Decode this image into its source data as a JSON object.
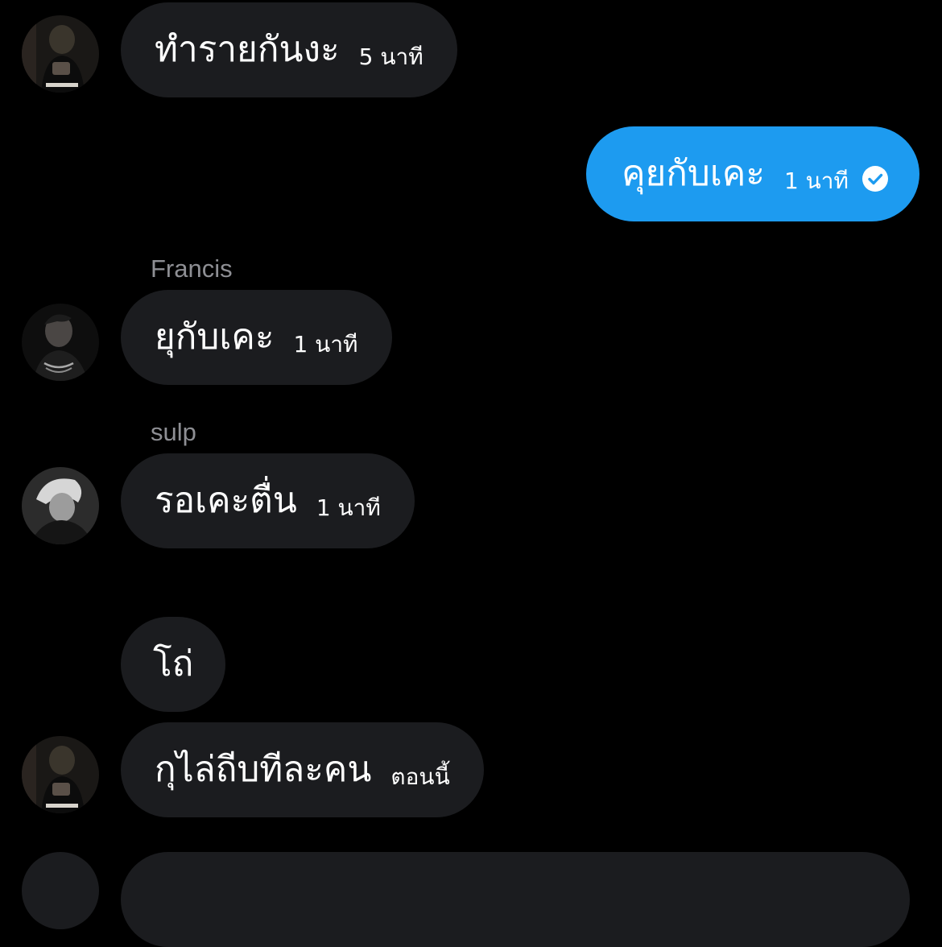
{
  "messages": [
    {
      "text": "ทำรายกันงะ",
      "time": "5 นาที",
      "direction": "incoming"
    },
    {
      "text": "คุยกับเคะ",
      "time": "1 นาที",
      "direction": "outgoing",
      "status_icon": "read-check-icon"
    },
    {
      "sender": "Francis",
      "text": "ยุกับเคะ",
      "time": "1 นาที",
      "direction": "incoming"
    },
    {
      "sender": "sulp",
      "text": "รอเคะตื่น",
      "time": "1 นาที",
      "direction": "incoming"
    },
    {
      "text": "โถ่",
      "direction": "incoming"
    },
    {
      "text": "กุไล่ถีบทีละคน",
      "time": "ตอนนี้",
      "direction": "incoming"
    }
  ],
  "colors": {
    "background": "#000000",
    "incoming_bubble": "#1b1c1f",
    "outgoing_bubble": "#1d9bf0",
    "sender_name": "#8e8f94",
    "text": "#ffffff"
  }
}
